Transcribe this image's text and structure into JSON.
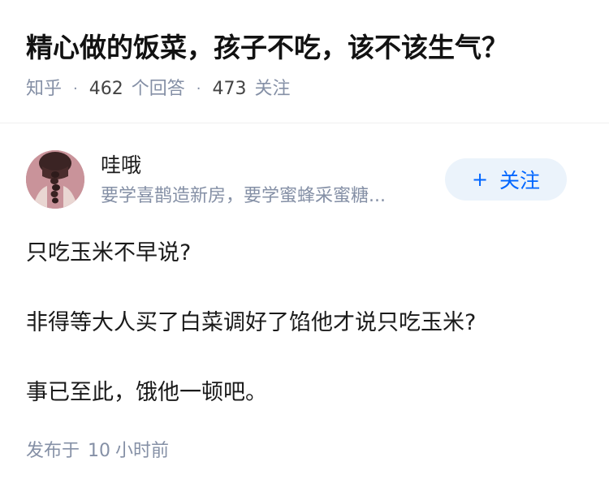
{
  "question": {
    "title": "精心做的饭菜，孩子不吃，该不该生气？",
    "site": "知乎",
    "separator": "·",
    "answers_count": "462",
    "answers_label": "个回答",
    "follow_count": "473",
    "follow_label": "关注"
  },
  "author": {
    "name": "哇哦",
    "bio": "要学喜鹊造新房，要学蜜蜂采蜜糖...",
    "avatar_icon": "avatar-braid-portrait",
    "follow_button_plus": "+",
    "follow_button_label": "关注"
  },
  "answer": {
    "paragraphs": [
      "只吃玉米不早说?",
      "非得等大人买了白菜调好了馅他才说只吃玉米?",
      "事已至此，饿他一顿吧。"
    ],
    "published_prefix": "发布于",
    "published_num": "10",
    "published_unit": "小时前"
  },
  "colors": {
    "accent": "#0066ff",
    "follow_bg": "#ebf3fb",
    "meta_text": "#8590a6",
    "title_text": "#121212"
  }
}
